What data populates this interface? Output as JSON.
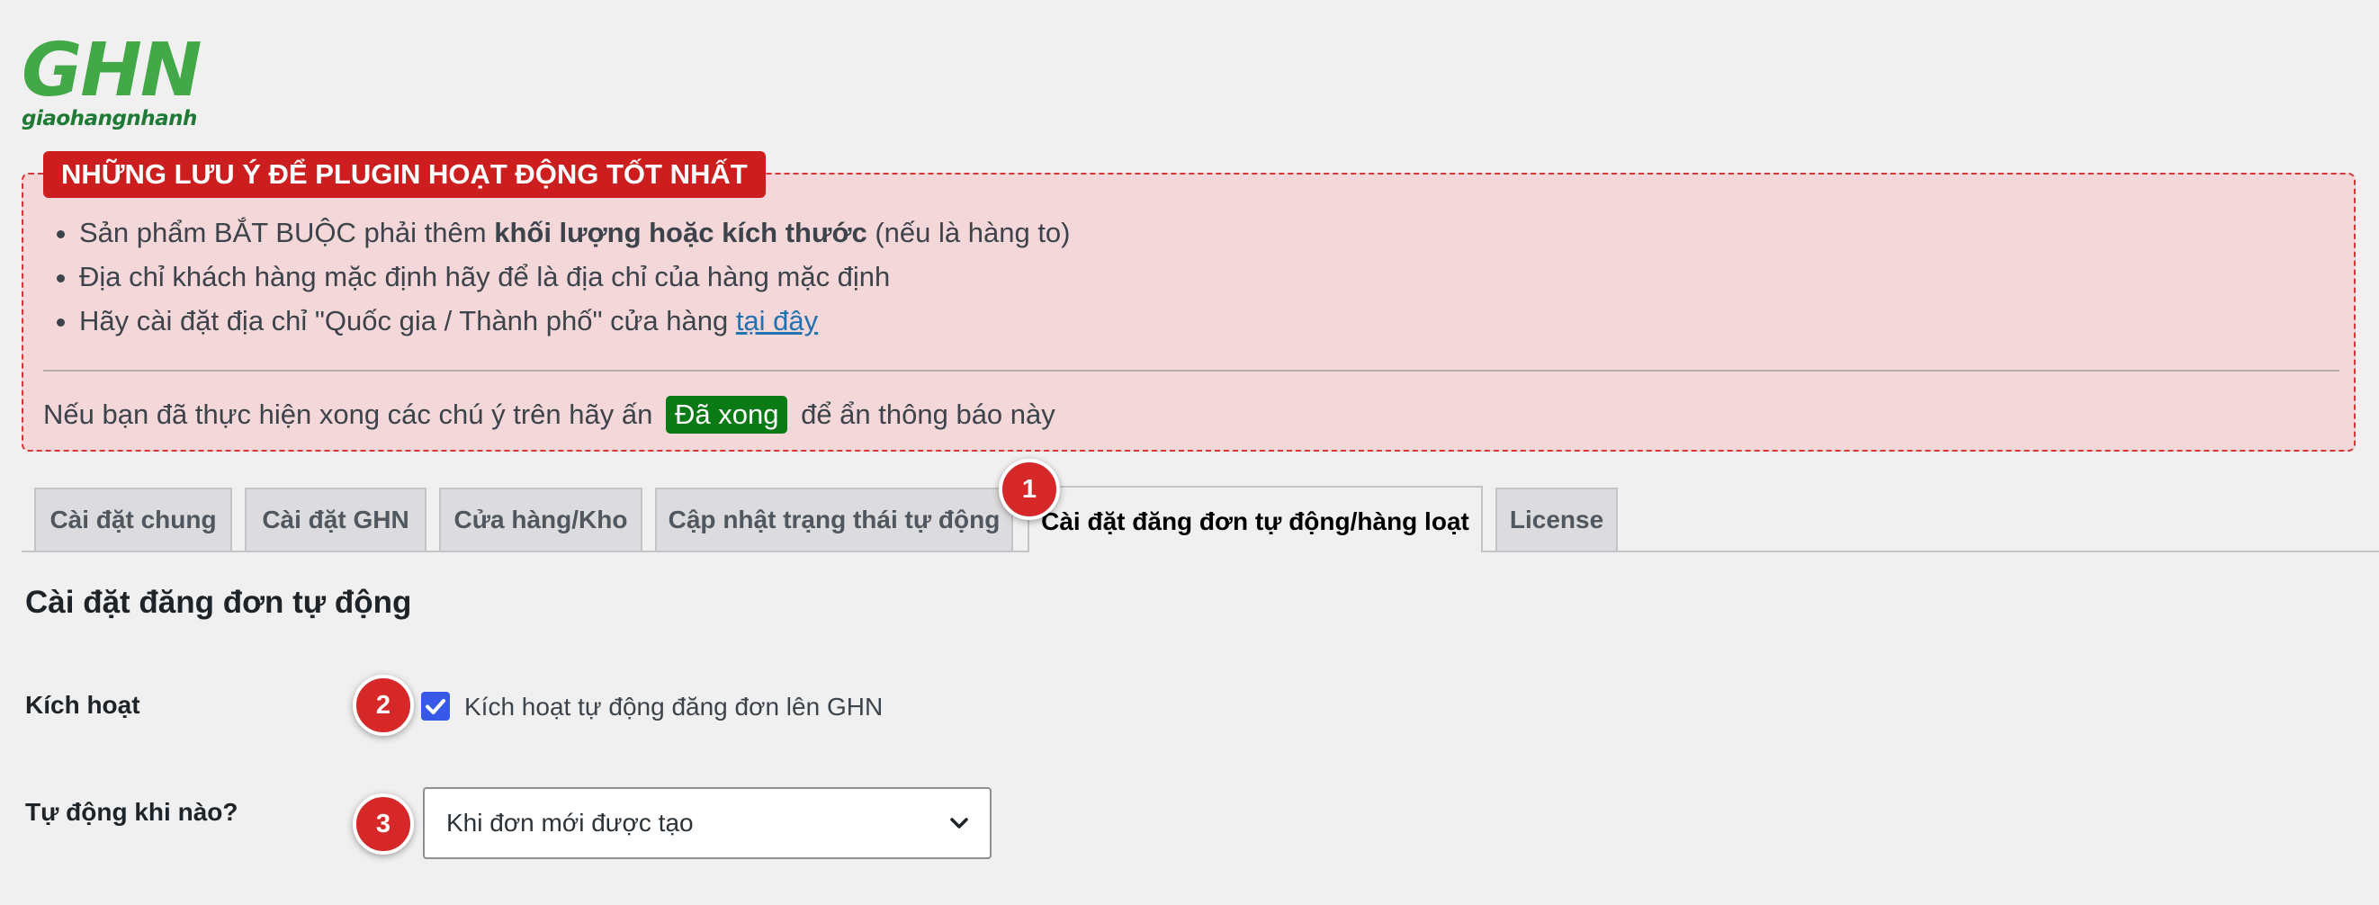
{
  "logo": {
    "mark": "GHN",
    "sub": "giaohangnhanh"
  },
  "notice": {
    "title": "NHỮNG LƯU Ý ĐỂ PLUGIN HOẠT ĐỘNG TỐT NHẤT",
    "item1_pre": "Sản phẩm BẮT BUỘC phải thêm ",
    "item1_bold": "khối lượng hoặc kích thước",
    "item1_post": " (nếu là hàng to)",
    "item2": "Địa chỉ khách hàng mặc định hãy để là địa chỉ của hàng mặc định",
    "item3_pre": "Hãy cài đặt địa chỉ \"Quốc gia / Thành phố\" cửa hàng ",
    "item3_link": "tại đây",
    "footer_pre": "Nếu bạn đã thực hiện xong các chú ý trên hãy ấn",
    "done_button": "Đã xong",
    "footer_post": "để ẩn thông báo này"
  },
  "tabs": [
    {
      "label": "Cài đặt chung"
    },
    {
      "label": "Cài đặt GHN"
    },
    {
      "label": "Cửa hàng/Kho"
    },
    {
      "label": "Cập nhật trạng thái tự động"
    },
    {
      "label": "Cài đặt đăng đơn tự động/hàng loạt"
    },
    {
      "label": "License"
    }
  ],
  "active_tab_index": 4,
  "badges": [
    "1",
    "2",
    "3"
  ],
  "section": {
    "title": "Cài đặt đăng đơn tự động",
    "activate_label": "Kích hoạt",
    "activate_checkbox_label": "Kích hoạt tự động đăng đơn lên GHN",
    "activate_checked": true,
    "when_label": "Tự động khi nào?",
    "when_value": "Khi đơn mới được tạo"
  },
  "colors": {
    "brand_green": "#43a847",
    "notice_bg": "#f4d7d9",
    "notice_border": "#d63638",
    "title_red": "#cc1e1e",
    "done_green": "#0a7a14",
    "checkbox_blue": "#3858e9",
    "badge_red": "#d62828"
  }
}
